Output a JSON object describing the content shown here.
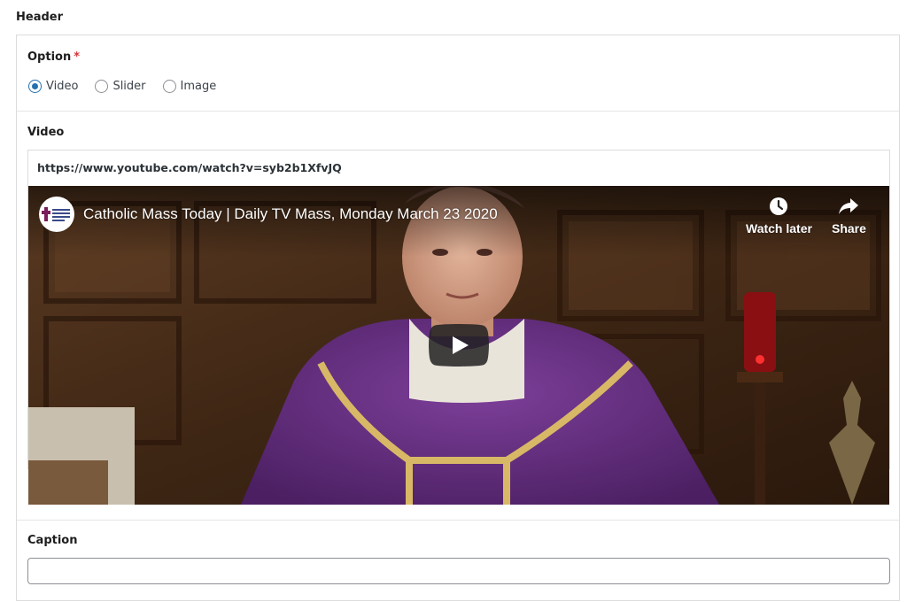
{
  "section": {
    "title": "Header"
  },
  "option_field": {
    "label": "Option",
    "required_mark": "*",
    "choices": [
      {
        "label": "Video",
        "checked": true
      },
      {
        "label": "Slider",
        "checked": false
      },
      {
        "label": "Image",
        "checked": false
      }
    ]
  },
  "video_field": {
    "label": "Video",
    "url": "https://www.youtube.com/watch?v=syb2b1XfvJQ",
    "player": {
      "title": "Catholic Mass Today | Daily TV Mass, Monday March 23 2020",
      "watch_later_label": "Watch later",
      "share_label": "Share",
      "watch_later_icon": "clock-icon",
      "share_icon": "share-arrow-icon",
      "play_icon": "play-icon",
      "logo": "channel-logo"
    }
  },
  "caption_field": {
    "label": "Caption",
    "value": ""
  },
  "colors": {
    "accent": "#2271b1",
    "required": "#d63638",
    "play_button": "#212121"
  }
}
